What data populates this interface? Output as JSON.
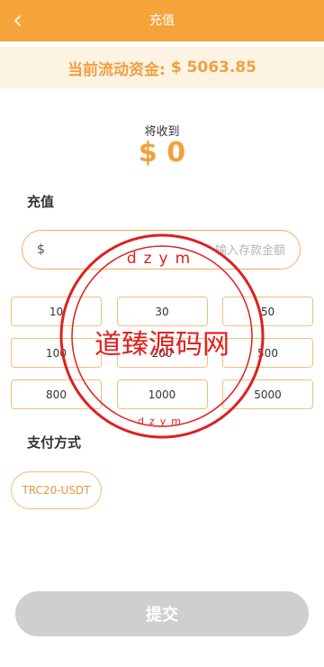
{
  "header": {
    "title": "充值",
    "back_icon": "chevron-left-icon"
  },
  "balance": {
    "label": "当前流动资金:",
    "value": "$ 5063.85"
  },
  "receive": {
    "label": "将收到",
    "amount": "$ 0"
  },
  "recharge": {
    "section_title": "充值",
    "currency_symbol": "$",
    "amount_input": {
      "value": "",
      "placeholder": "输入存款金额"
    },
    "presets": [
      "10",
      "30",
      "50",
      "100",
      "200",
      "500",
      "800",
      "1000",
      "5000"
    ]
  },
  "payment": {
    "section_title": "支付方式",
    "method": "TRC20-USDT"
  },
  "submit_label": "提交",
  "watermark": {
    "text": "道臻源码网",
    "ring_top": "dzym",
    "ring_bottom": "dzym",
    "color": "#e01f1f"
  },
  "colors": {
    "accent": "#f5a43a",
    "balance_bg": "#fdf3e3",
    "disabled": "#cfcfcf"
  }
}
